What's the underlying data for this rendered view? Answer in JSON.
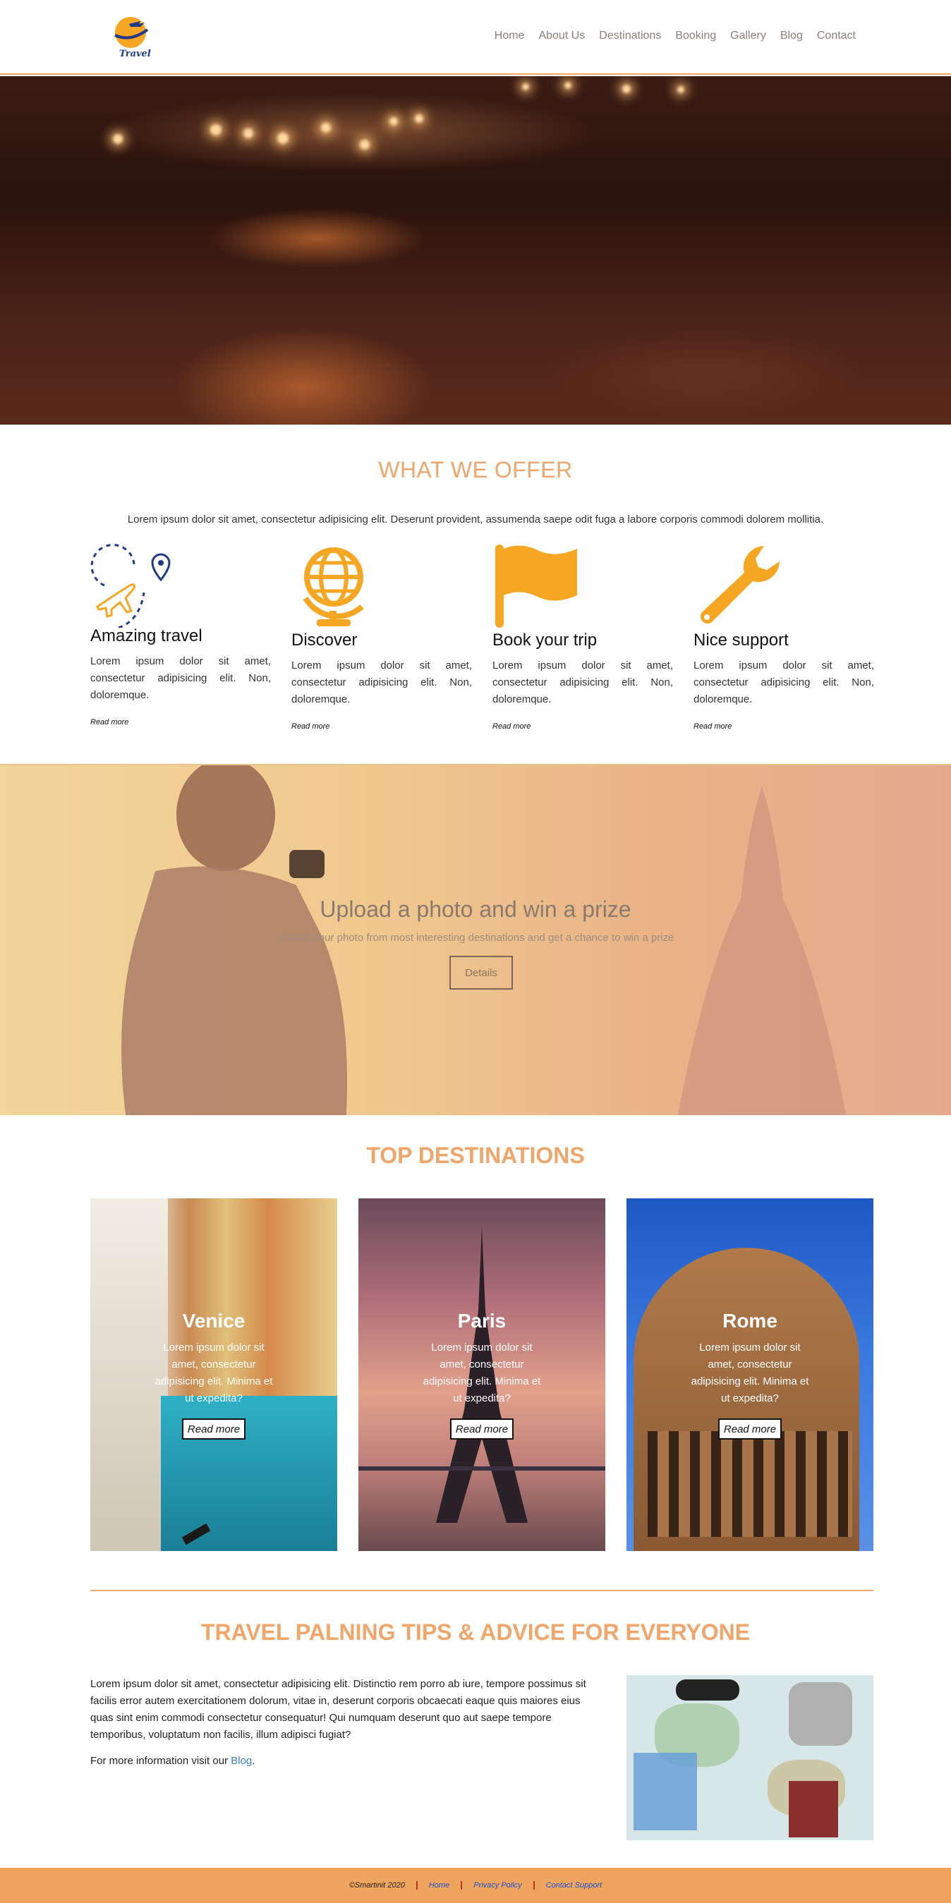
{
  "header": {
    "logo_text": "Travel",
    "nav": [
      "Home",
      "About Us",
      "Destinations",
      "Booking",
      "Gallery",
      "Blog",
      "Contact"
    ]
  },
  "offer": {
    "title": "WHAT WE OFFER",
    "intro": "Lorem ipsum dolor sit amet, consectetur adipisicing elit. Deserunt provident, assumenda saepe odit fuga a labore corporis commodi dolorem mollitia.",
    "features": [
      {
        "icon": "plane-route-icon",
        "title": "Amazing travel",
        "text": "Lorem ipsum dolor sit amet, consectetur adipisicing elit. Non, doloremque.",
        "link": "Read more"
      },
      {
        "icon": "globe-icon",
        "title": "Discover",
        "text": "Lorem ipsum dolor sit amet, consectetur adipisicing elit. Non, doloremque.",
        "link": "Read more"
      },
      {
        "icon": "flag-icon",
        "title": "Book your trip",
        "text": "Lorem ipsum dolor sit amet, consectetur adipisicing elit. Non, doloremque.",
        "link": "Read more"
      },
      {
        "icon": "wrench-icon",
        "title": "Nice support",
        "text": "Lorem ipsum dolor sit amet, consectetur adipisicing elit. Non, doloremque.",
        "link": "Read more"
      }
    ]
  },
  "upload": {
    "title": "Upload a photo and win a prize",
    "subtitle": "Upload your photo from most interesting destinations and get a chance to win a prize",
    "button": "Details"
  },
  "destinations": {
    "title": "TOP DESTINATIONS",
    "cards": [
      {
        "name": "Venice",
        "text": "Lorem ipsum dolor sit amet, consectetur adipisicing elit. Minima et ut expedita?",
        "button": "Read more"
      },
      {
        "name": "Paris",
        "text": "Lorem ipsum dolor sit amet, consectetur adipisicing elit. Minima et ut expedita?",
        "button": "Read more"
      },
      {
        "name": "Rome",
        "text": "Lorem ipsum dolor sit amet, consectetur adipisicing elit. Minima et ut expedita?",
        "button": "Read more"
      }
    ]
  },
  "tips": {
    "title": "TRAVEL PALNING TIPS & ADVICE FOR EVERYONE",
    "text": "Lorem ipsum dolor sit amet, consectetur adipisicing elit. Distinctio rem porro ab iure, tempore possimus sit facilis error autem exercitationem dolorum, vitae in, deserunt corporis obcaecati eaque quis maiores eius quas sint enim commodi consectetur consequatur! Qui numquam deserunt quo aut saepe tempore temporibus, voluptatum non facilis, illum adipisci fugiat?",
    "more_prefix": "For more information visit our ",
    "more_link": "Blog",
    "more_suffix": "."
  },
  "footer": {
    "copyright": "©Smartinit 2020",
    "links": [
      "Home",
      "Privacy Policy",
      "Contact Support"
    ]
  },
  "colors": {
    "accent": "#f0a56a",
    "footer": "#f0a55e",
    "icon": "#f5a623",
    "navy": "#1f3a8a"
  }
}
